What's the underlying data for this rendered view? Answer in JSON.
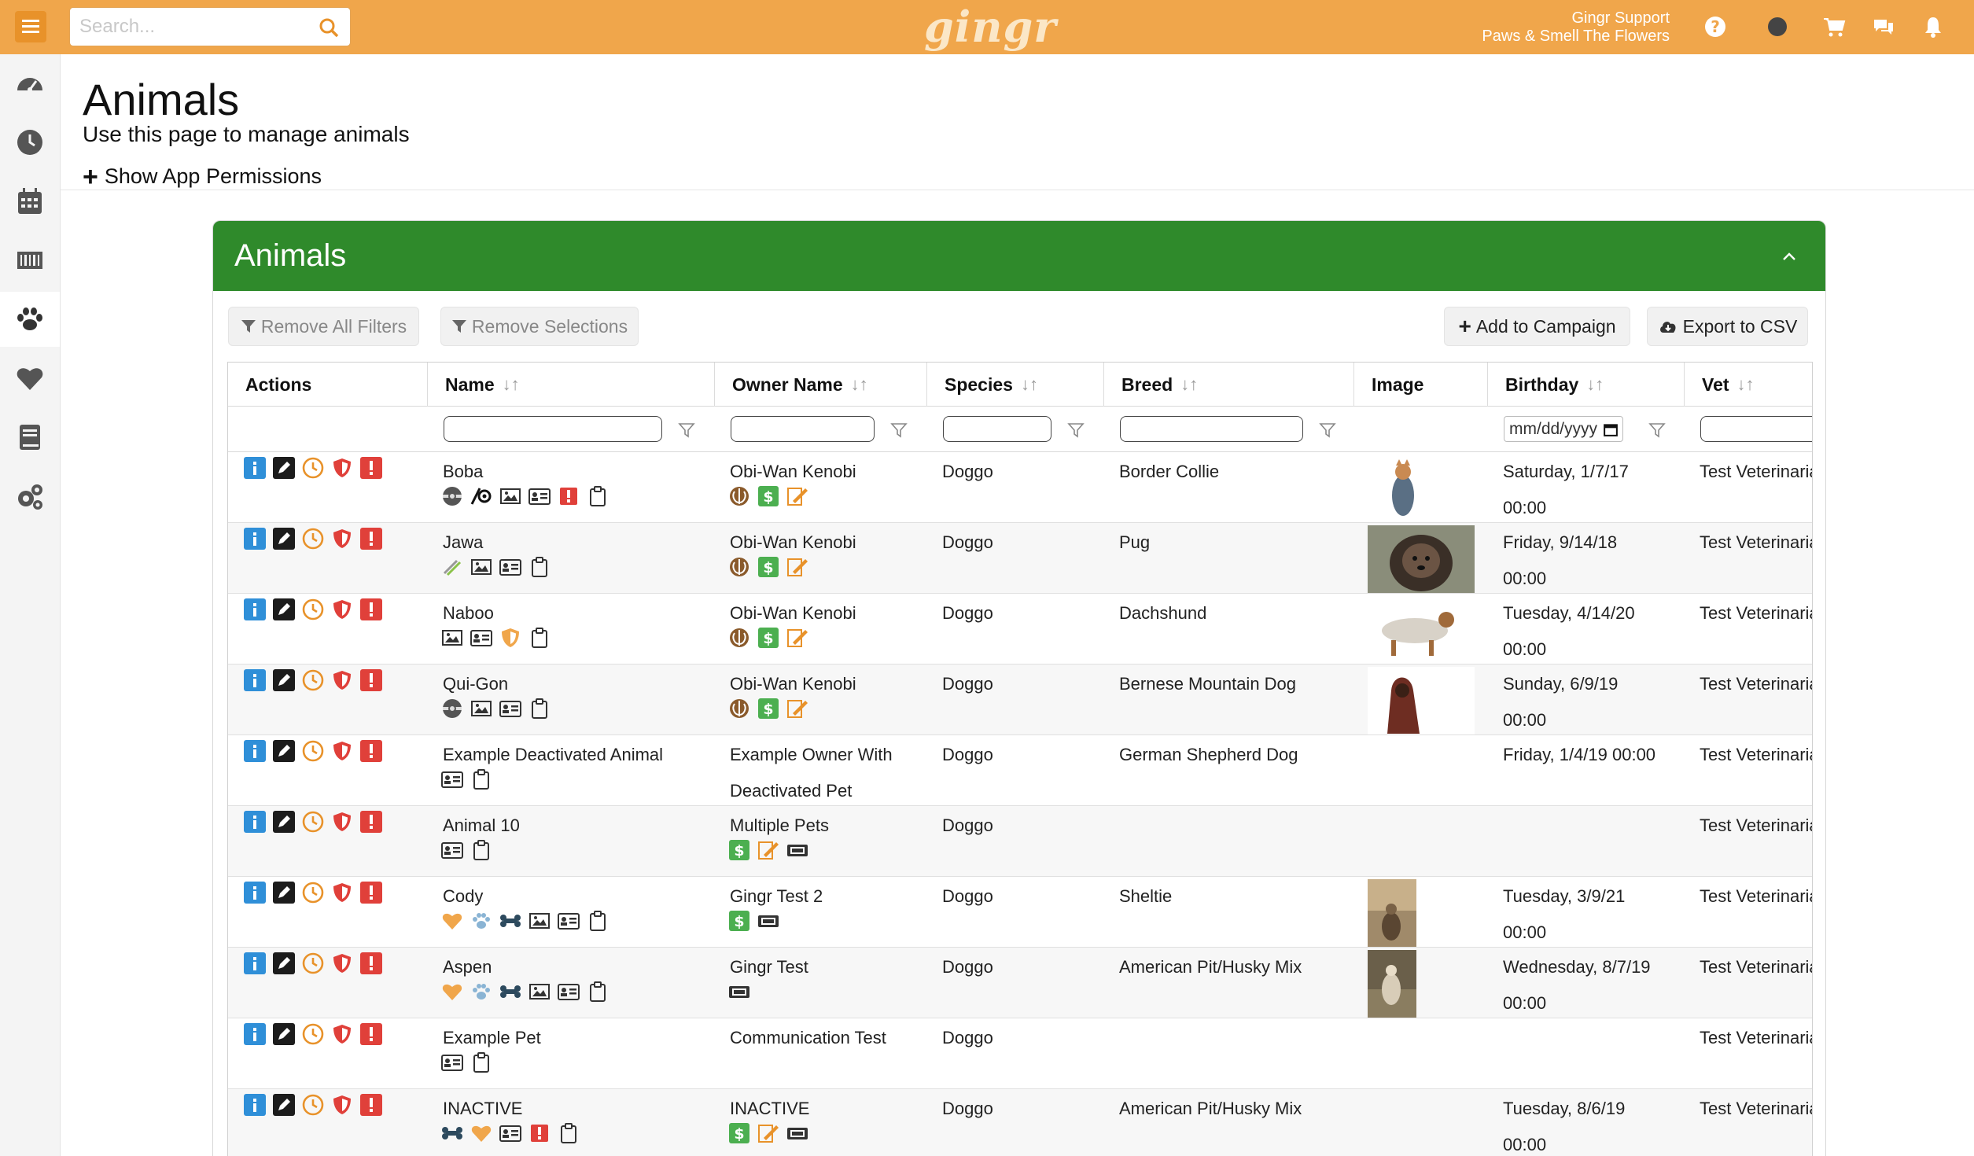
{
  "topbar": {
    "search_placeholder": "Search...",
    "logo": "gingr",
    "user_line1": "Gingr Support",
    "user_line2": "Paws & Smell The Flowers"
  },
  "header": {
    "title": "Animals",
    "subtitle": "Use this page to manage animals",
    "permissions": "Show App Permissions"
  },
  "panel": {
    "title": "Animals",
    "remove_filters": "Remove All Filters",
    "remove_selections": "Remove Selections",
    "add_campaign": "Add to Campaign",
    "export_csv": "Export to CSV"
  },
  "columns": {
    "actions": "Actions",
    "name": "Name",
    "owner": "Owner Name",
    "species": "Species",
    "breed": "Breed",
    "image": "Image",
    "birthday": "Birthday",
    "vet": "Vet",
    "date_placeholder": "mm/dd/yyyy"
  },
  "rows": [
    {
      "name": "Boba",
      "owner": "Obi-Wan Kenobi",
      "owner2": "",
      "species": "Doggo",
      "breed": "Border Collie",
      "bday": "Saturday, 1/7/17",
      "bday2": "00:00",
      "vet": "Test Veterinarian"
    },
    {
      "name": "Jawa",
      "owner": "Obi-Wan Kenobi",
      "owner2": "",
      "species": "Doggo",
      "breed": "Pug",
      "bday": "Friday, 9/14/18",
      "bday2": "00:00",
      "vet": "Test Veterinarian"
    },
    {
      "name": "Naboo",
      "owner": "Obi-Wan Kenobi",
      "owner2": "",
      "species": "Doggo",
      "breed": "Dachshund",
      "bday": "Tuesday, 4/14/20",
      "bday2": "00:00",
      "vet": "Test Veterinarian"
    },
    {
      "name": "Qui-Gon",
      "owner": "Obi-Wan Kenobi",
      "owner2": "",
      "species": "Doggo",
      "breed": "Bernese Mountain Dog",
      "bday": "Sunday, 6/9/19",
      "bday2": "00:00",
      "vet": "Test Veterinarian"
    },
    {
      "name": "Example Deactivated Animal",
      "owner": "Example Owner With",
      "owner2": "Deactivated Pet",
      "species": "Doggo",
      "breed": "German Shepherd Dog",
      "bday": "Friday, 1/4/19 00:00",
      "bday2": "",
      "vet": "Test Veterinarian"
    },
    {
      "name": "Animal 10",
      "owner": "Multiple Pets",
      "owner2": "",
      "species": "Doggo",
      "breed": "",
      "bday": "",
      "bday2": "",
      "vet": "Test Veterinarian"
    },
    {
      "name": "Cody",
      "owner": "Gingr Test 2",
      "owner2": "",
      "species": "Doggo",
      "breed": "Sheltie",
      "bday": "Tuesday, 3/9/21",
      "bday2": "00:00",
      "vet": "Test Veterinarian"
    },
    {
      "name": "Aspen",
      "owner": "Gingr Test",
      "owner2": "",
      "species": "Doggo",
      "breed": "American Pit/Husky Mix",
      "bday": "Wednesday, 8/7/19",
      "bday2": "00:00",
      "vet": "Test Veterinarian"
    },
    {
      "name": "Example Pet",
      "owner": "Communication Test",
      "owner2": "",
      "species": "Doggo",
      "breed": "",
      "bday": "",
      "bday2": "",
      "vet": "Test Veterinarian"
    },
    {
      "name": "INACTIVE",
      "owner": "INACTIVE",
      "owner2": "",
      "species": "Doggo",
      "breed": "American Pit/Husky Mix",
      "bday": "Tuesday, 8/6/19",
      "bday2": "00:00",
      "vet": "Test Veterinarian"
    }
  ],
  "colors": {
    "topbar": "#f0a64b",
    "panel_header": "#2f8a2b",
    "info": "#2f8fd8",
    "danger": "#e0403a",
    "orange": "#e8922a",
    "money": "#4caf50"
  }
}
